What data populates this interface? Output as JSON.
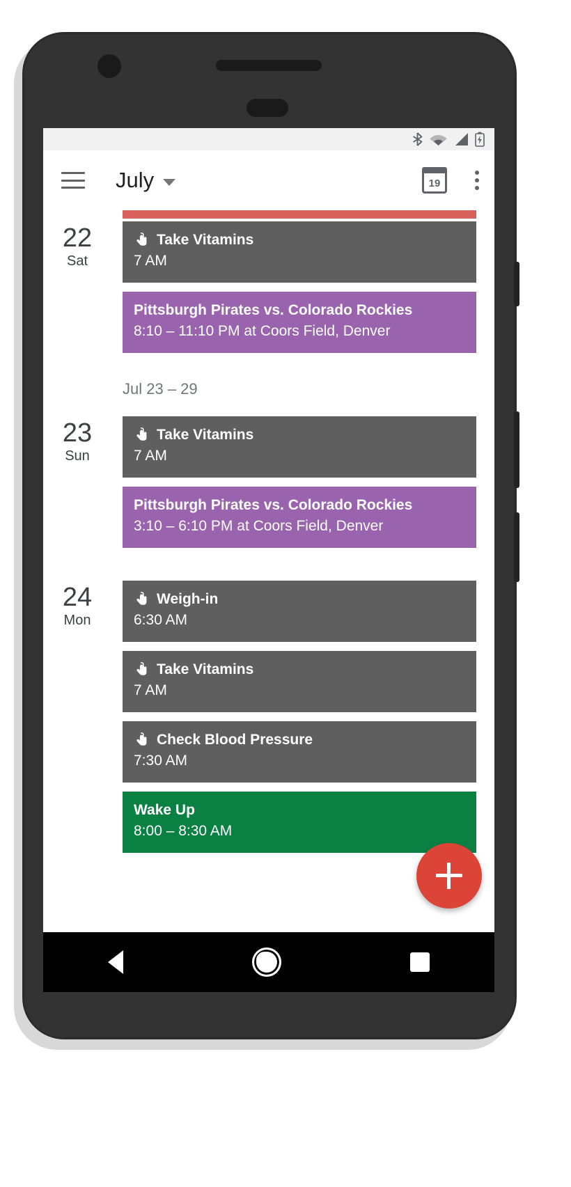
{
  "status_bar": {
    "icons": [
      "bluetooth-icon",
      "wifi-icon",
      "cell-signal-icon",
      "battery-icon"
    ]
  },
  "app_bar": {
    "menu_icon": "hamburger-menu-icon",
    "title": "July",
    "caret_icon": "dropdown-caret-icon",
    "today_icon": "calendar-today-icon",
    "today_icon_number": "19",
    "overflow_icon": "more-options-icon"
  },
  "agenda": {
    "week_header": "Jul 23 – 29",
    "days": [
      {
        "day_number": "22",
        "day_name": "Sat",
        "events": [
          {
            "title": "Take Vitamins",
            "subtitle": "7 AM",
            "color": "#5f5f5f",
            "icon": "reminder-hand-icon"
          },
          {
            "title": "Pittsburgh Pirates vs. Colorado Rockies",
            "subtitle": "8:10 – 11:10 PM at Coors Field, Denver",
            "color": "#9a63ad",
            "icon": ""
          }
        ]
      },
      {
        "day_number": "23",
        "day_name": "Sun",
        "events": [
          {
            "title": "Take Vitamins",
            "subtitle": "7 AM",
            "color": "#5f5f5f",
            "icon": "reminder-hand-icon"
          },
          {
            "title": "Pittsburgh Pirates vs. Colorado Rockies",
            "subtitle": "3:10 – 6:10 PM at Coors Field, Denver",
            "color": "#9a63ad",
            "icon": ""
          }
        ]
      },
      {
        "day_number": "24",
        "day_name": "Mon",
        "events": [
          {
            "title": "Weigh-in",
            "subtitle": "6:30 AM",
            "color": "#5f5f5f",
            "icon": "reminder-hand-icon"
          },
          {
            "title": "Take Vitamins",
            "subtitle": "7 AM",
            "color": "#5f5f5f",
            "icon": "reminder-hand-icon"
          },
          {
            "title": "Check Blood Pressure",
            "subtitle": "7:30 AM",
            "color": "#5f5f5f",
            "icon": "reminder-hand-icon"
          },
          {
            "title": "Wake Up",
            "subtitle": "8:00 – 8:30 AM",
            "color": "#0b8043",
            "icon": ""
          }
        ]
      }
    ],
    "cut_off_event_color": "#d9615c"
  },
  "fab": {
    "icon": "plus-icon",
    "color": "#db4437"
  },
  "nav_bar": {
    "back_icon": "nav-back-triangle-icon",
    "home_icon": "nav-home-circle-icon",
    "recents_icon": "nav-recents-square-icon"
  }
}
